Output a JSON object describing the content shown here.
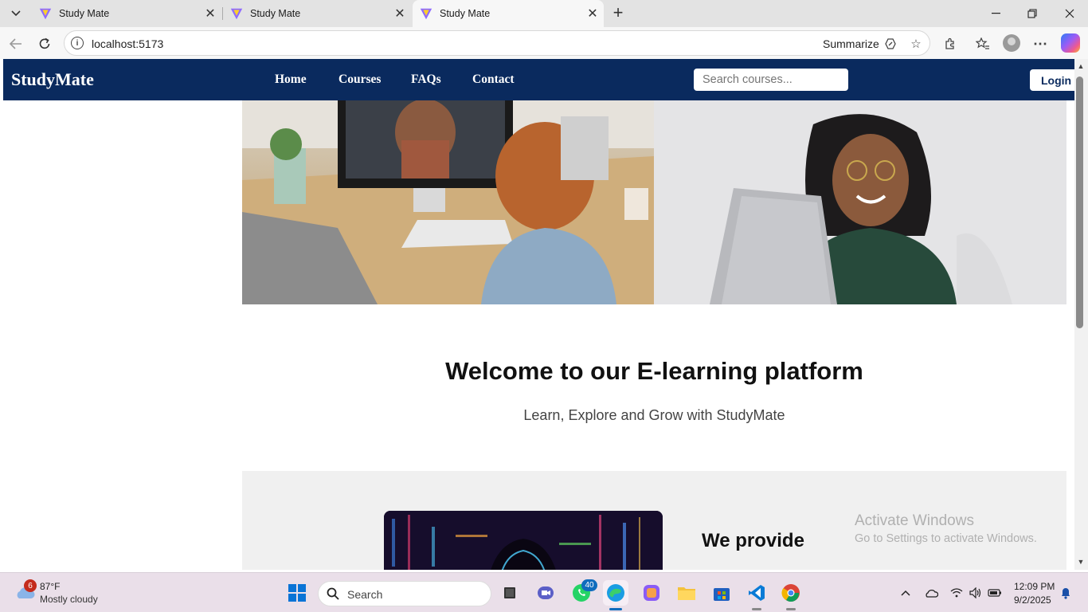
{
  "browser": {
    "tabs": [
      {
        "title": "Study Mate"
      },
      {
        "title": "Study Mate"
      },
      {
        "title": "Study Mate"
      }
    ],
    "address": "localhost:5173",
    "summarize_label": "Summarize"
  },
  "site": {
    "brand": "StudyMate",
    "nav": [
      "Home",
      "Courses",
      "FAQs",
      "Contact"
    ],
    "search_placeholder": "Search courses...",
    "login_label": "Login",
    "welcome_heading": "Welcome to our E-learning platform",
    "tagline": "Learn, Explore and Grow with StudyMate",
    "provide_heading": "We provide"
  },
  "watermark": {
    "line1": "Activate Windows",
    "line2": "Go to Settings to activate Windows."
  },
  "taskbar": {
    "weather_badge": "6",
    "temperature": "87°F",
    "condition": "Mostly cloudy",
    "search_label": "Search",
    "whatsapp_badge": "40",
    "time": "12:09 PM",
    "date": "9/2/2025"
  }
}
